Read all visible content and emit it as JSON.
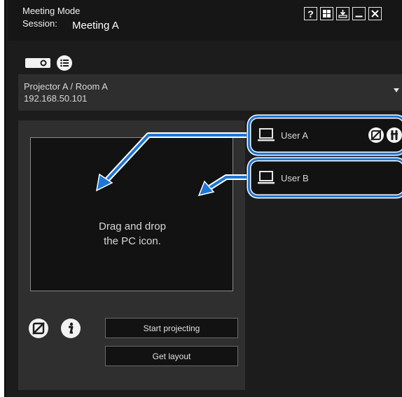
{
  "window": {
    "title": "Meeting Mode",
    "session_label": "Session:",
    "session_value": "Meeting A",
    "buttons": {
      "help": "?",
      "grid": "grid-icon",
      "download": "download-icon",
      "minimize": "minimize-icon",
      "close": "close-icon"
    }
  },
  "toolbar": {
    "projector_icon": "projector-icon",
    "list_icon": "list-icon"
  },
  "projector_select": {
    "name": "Projector A / Room A",
    "ip": "192.168.50.101"
  },
  "layout": {
    "drop_hint_line1": "Drag and drop",
    "drop_hint_line2": "the PC icon.",
    "start_projecting": "Start projecting",
    "get_layout": "Get layout"
  },
  "users": [
    {
      "name": "User A",
      "icons": [
        "no-display-icon",
        "key-icon"
      ]
    },
    {
      "name": "User B",
      "icons": []
    }
  ],
  "colors": {
    "background": "#1c1c1c",
    "panel": "#2f2f2f",
    "accent_highlight": "#1d77d6",
    "text": "#d8d8d8"
  }
}
